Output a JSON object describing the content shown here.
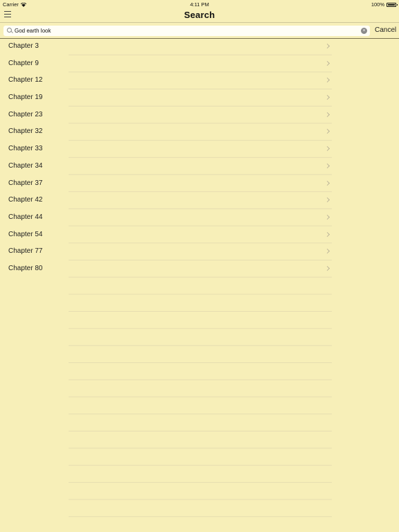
{
  "status_bar": {
    "carrier": "Carrier",
    "time": "4:11 PM",
    "battery": "100%"
  },
  "nav": {
    "title": "Search",
    "menu_icon": "hamburger-menu-icon"
  },
  "search": {
    "value": "God earth look",
    "placeholder": "Search",
    "cancel_label": "Cancel",
    "clear_icon": "clear-icon"
  },
  "results": [
    {
      "label": "Chapter 3"
    },
    {
      "label": "Chapter 9"
    },
    {
      "label": "Chapter 12"
    },
    {
      "label": "Chapter 19"
    },
    {
      "label": "Chapter 23"
    },
    {
      "label": "Chapter 32"
    },
    {
      "label": "Chapter 33"
    },
    {
      "label": "Chapter 34"
    },
    {
      "label": "Chapter 37"
    },
    {
      "label": "Chapter 42"
    },
    {
      "label": "Chapter 44"
    },
    {
      "label": "Chapter 54"
    },
    {
      "label": "Chapter 77"
    },
    {
      "label": "Chapter 80"
    }
  ],
  "colors": {
    "background": "#f7efb8",
    "text": "#222222"
  }
}
